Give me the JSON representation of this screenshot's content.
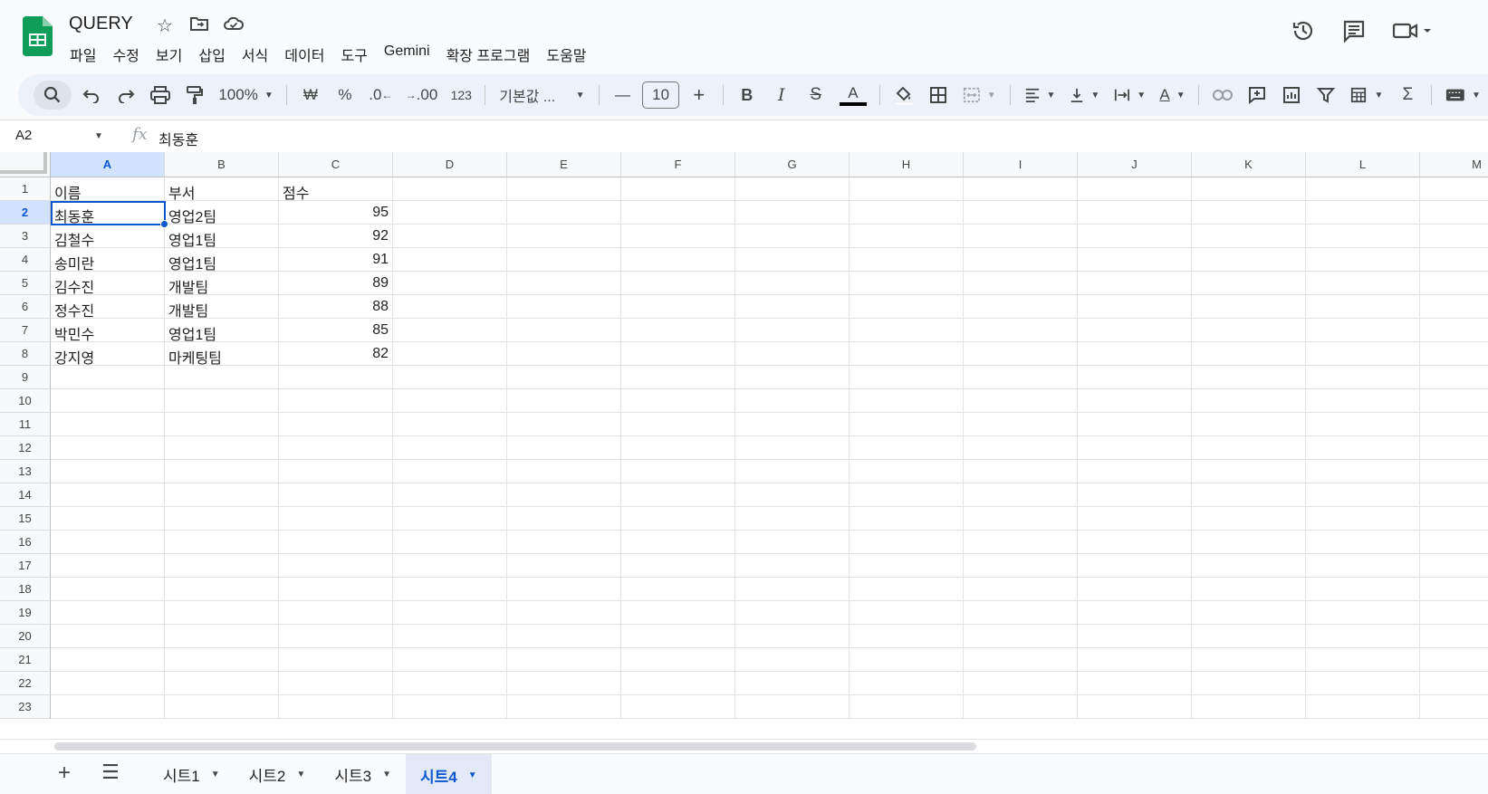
{
  "app": {
    "doc_title": "QUERY",
    "brand_color": "#0f9d58",
    "accent_color": "#0b57d0"
  },
  "menu": [
    "파일",
    "수정",
    "보기",
    "삽입",
    "서식",
    "데이터",
    "도구",
    "Gemini",
    "확장 프로그램",
    "도움말"
  ],
  "toolbar": {
    "zoom": "100%",
    "currency": "₩",
    "percent": "%",
    "decimal_decrease": ".0",
    "decimal_increase": ".00",
    "number_format": "123",
    "font_name": "기본값 ...",
    "font_size": "10"
  },
  "formula_bar": {
    "cell_ref": "A2",
    "value": "최동훈"
  },
  "columns": [
    "A",
    "B",
    "C",
    "D",
    "E",
    "F",
    "G",
    "H",
    "I",
    "J",
    "K",
    "L",
    "M"
  ],
  "selected_column": "A",
  "selected_row": "2",
  "rows": [
    "1",
    "2",
    "3",
    "4",
    "5",
    "6",
    "7",
    "8",
    "9",
    "10",
    "11",
    "12",
    "13",
    "14",
    "15",
    "16",
    "17",
    "18",
    "19",
    "20",
    "21",
    "22",
    "23"
  ],
  "data": [
    [
      "이름",
      "부서",
      "점수"
    ],
    [
      "최동훈",
      "영업2팀",
      "95"
    ],
    [
      "김철수",
      "영업1팀",
      "92"
    ],
    [
      "송미란",
      "영업1팀",
      "91"
    ],
    [
      "김수진",
      "개발팀",
      "89"
    ],
    [
      "정수진",
      "개발팀",
      "88"
    ],
    [
      "박민수",
      "영업1팀",
      "85"
    ],
    [
      "강지영",
      "마케팅팀",
      "82"
    ]
  ],
  "sheets": [
    {
      "label": "시트1",
      "active": false
    },
    {
      "label": "시트2",
      "active": false
    },
    {
      "label": "시트3",
      "active": false
    },
    {
      "label": "시트4",
      "active": true
    }
  ]
}
